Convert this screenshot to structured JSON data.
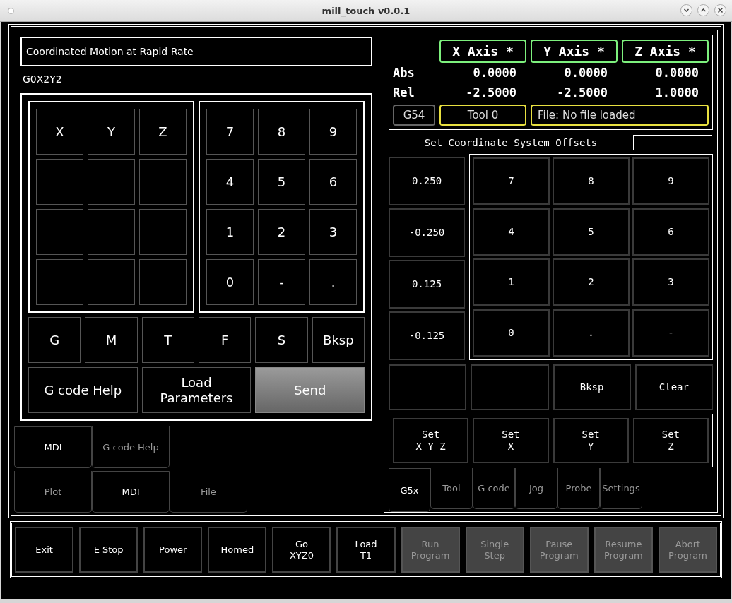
{
  "window": {
    "title": "mill_touch v0.0.1"
  },
  "mdi": {
    "status": "Coordinated Motion at Rapid Rate",
    "command": "G0X2Y2",
    "axis_keys": [
      "X",
      "Y",
      "Z"
    ],
    "number_keys": [
      "7",
      "8",
      "9",
      "4",
      "5",
      "6",
      "1",
      "2",
      "3",
      "0",
      "-",
      "."
    ],
    "letter_keys": [
      "G",
      "M",
      "T",
      "F",
      "S",
      "Bksp"
    ],
    "actions": [
      {
        "label": "G code Help",
        "kind": "plain"
      },
      {
        "label": "Load\nParameters",
        "kind": "plain"
      },
      {
        "label": "Send",
        "kind": "primary"
      }
    ]
  },
  "left_tab_bars": [
    [
      {
        "label": "MDI",
        "selected": true
      },
      {
        "label": "G code Help",
        "selected": false
      }
    ],
    [
      {
        "label": "Plot",
        "selected": false
      },
      {
        "label": "MDI",
        "selected": true
      },
      {
        "label": "File",
        "selected": false
      }
    ]
  ],
  "dro": {
    "axes": [
      "X Axis *",
      "Y Axis *",
      "Z Axis *"
    ],
    "rows": [
      {
        "label": "Abs",
        "values": [
          "0.0000",
          "0.0000",
          "0.0000"
        ]
      },
      {
        "label": "Rel",
        "values": [
          "-2.5000",
          "-2.5000",
          "1.0000"
        ]
      }
    ],
    "coord_system": "G54",
    "tool": "Tool 0",
    "file": "File: No file loaded"
  },
  "offsets": {
    "title": "Set Coordinate System Offsets",
    "increments": [
      "0.250",
      "-0.250",
      "0.125",
      "-0.125"
    ],
    "keys": [
      "7",
      "8",
      "9",
      "4",
      "5",
      "6",
      "1",
      "2",
      "3",
      "0",
      ".",
      "-"
    ],
    "edit_keys": [
      "Bksp",
      "Clear"
    ],
    "set_buttons": [
      "Set\nX Y Z",
      "Set\nX",
      "Set\nY",
      "Set\nZ"
    ]
  },
  "right_tabs": [
    {
      "label": "G5x",
      "selected": true
    },
    {
      "label": "Tool",
      "selected": false
    },
    {
      "label": "G code",
      "selected": false
    },
    {
      "label": "Jog",
      "selected": false
    },
    {
      "label": "Probe",
      "selected": false
    },
    {
      "label": "Settings",
      "selected": false
    }
  ],
  "controls": [
    {
      "label": "Exit",
      "disabled": false
    },
    {
      "label": "E Stop",
      "disabled": false
    },
    {
      "label": "Power",
      "disabled": false
    },
    {
      "label": "Homed",
      "disabled": false
    },
    {
      "label": "Go\nXYZ0",
      "disabled": false
    },
    {
      "label": "Load\nT1",
      "disabled": false
    },
    {
      "label": "Run\nProgram",
      "disabled": true
    },
    {
      "label": "Single\nStep",
      "disabled": true
    },
    {
      "label": "Pause\nProgram",
      "disabled": true
    },
    {
      "label": "Resume\nProgram",
      "disabled": true
    },
    {
      "label": "Abort\nProgram",
      "disabled": true
    }
  ]
}
